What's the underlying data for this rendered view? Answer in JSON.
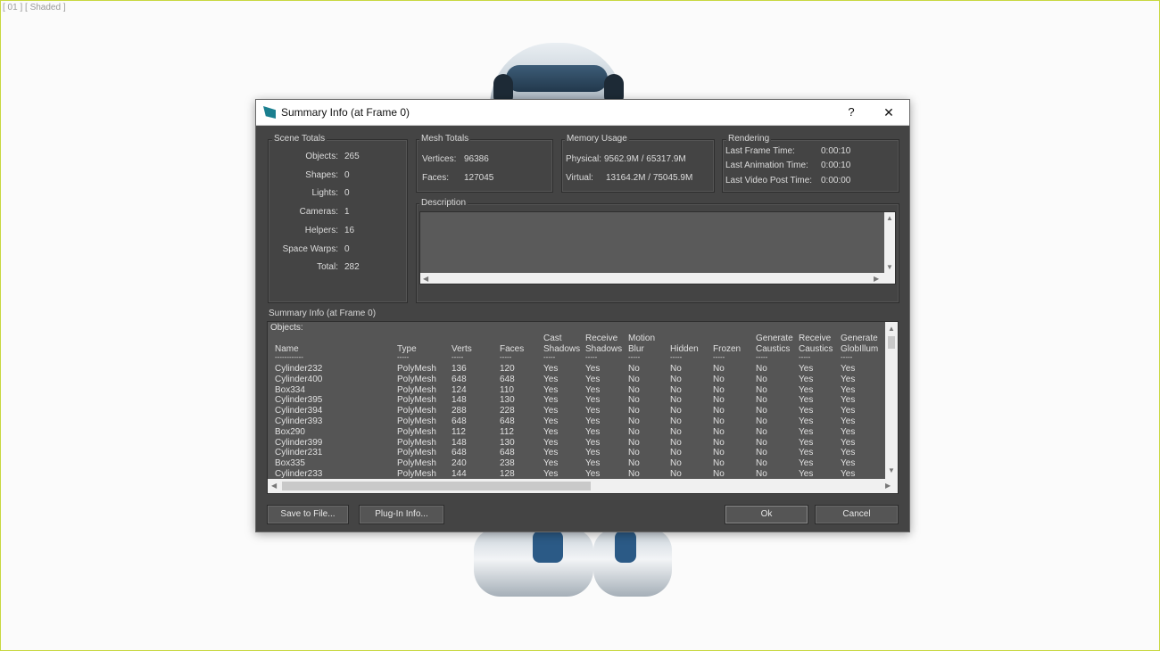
{
  "viewport": {
    "label": "[ 01 ] [ Shaded ]"
  },
  "dialog": {
    "title": "Summary Info (at Frame 0)",
    "help": "?",
    "close": "✕"
  },
  "scene_totals": {
    "title": "Scene Totals",
    "rows": [
      {
        "label": "Objects:",
        "value": "265"
      },
      {
        "label": "Shapes:",
        "value": "0"
      },
      {
        "label": "Lights:",
        "value": "0"
      },
      {
        "label": "Cameras:",
        "value": "1"
      },
      {
        "label": "Helpers:",
        "value": "16"
      },
      {
        "label": "Space Warps:",
        "value": "0"
      },
      {
        "label": "Total:",
        "value": "282"
      }
    ]
  },
  "mesh_totals": {
    "title": "Mesh Totals",
    "rows": [
      {
        "label": "Vertices:",
        "value": "96386"
      },
      {
        "label": "Faces:",
        "value": "127045"
      }
    ]
  },
  "memory_usage": {
    "title": "Memory Usage",
    "rows": [
      {
        "label": "Physical:",
        "value": "9562.9M / 65317.9M"
      },
      {
        "label": "Virtual:",
        "value": "13164.2M / 75045.9M"
      }
    ]
  },
  "rendering": {
    "title": "Rendering",
    "rows": [
      {
        "label": "Last Frame Time:",
        "value": "0:00:10"
      },
      {
        "label": "Last Animation Time:",
        "value": "0:00:10"
      },
      {
        "label": "Last Video Post Time:",
        "value": "0:00:00"
      }
    ]
  },
  "description": {
    "title": "Description",
    "value": ""
  },
  "summary": {
    "label": "Summary Info (at Frame 0)",
    "objects_heading": "Objects:",
    "columns": [
      {
        "line1": "",
        "line2": "Name"
      },
      {
        "line1": "",
        "line2": "Type"
      },
      {
        "line1": "",
        "line2": "Verts"
      },
      {
        "line1": "",
        "line2": "Faces"
      },
      {
        "line1": "Cast",
        "line2": "Shadows"
      },
      {
        "line1": "Receive",
        "line2": "Shadows"
      },
      {
        "line1": "Motion",
        "line2": "Blur"
      },
      {
        "line1": "",
        "line2": "Hidden"
      },
      {
        "line1": "",
        "line2": "Frozen"
      },
      {
        "line1": "Generate",
        "line2": "Caustics"
      },
      {
        "line1": "Receive",
        "line2": "Caustics"
      },
      {
        "line1": "Generate",
        "line2": "GlobIllum"
      }
    ],
    "separators": [
      "------------",
      "-----",
      "-----",
      "-----",
      "-----",
      "-----",
      "-----",
      "-----",
      "-----",
      "-----",
      "-----",
      "-----"
    ],
    "rows": [
      [
        "Cylinder232",
        "PolyMesh",
        "136",
        "120",
        "Yes",
        "Yes",
        "No",
        "No",
        "No",
        "No",
        "Yes",
        "Yes"
      ],
      [
        "Cylinder400",
        "PolyMesh",
        "648",
        "648",
        "Yes",
        "Yes",
        "No",
        "No",
        "No",
        "No",
        "Yes",
        "Yes"
      ],
      [
        "Box334",
        "PolyMesh",
        "124",
        "110",
        "Yes",
        "Yes",
        "No",
        "No",
        "No",
        "No",
        "Yes",
        "Yes"
      ],
      [
        "Cylinder395",
        "PolyMesh",
        "148",
        "130",
        "Yes",
        "Yes",
        "No",
        "No",
        "No",
        "No",
        "Yes",
        "Yes"
      ],
      [
        "Cylinder394",
        "PolyMesh",
        "288",
        "228",
        "Yes",
        "Yes",
        "No",
        "No",
        "No",
        "No",
        "Yes",
        "Yes"
      ],
      [
        "Cylinder393",
        "PolyMesh",
        "648",
        "648",
        "Yes",
        "Yes",
        "No",
        "No",
        "No",
        "No",
        "Yes",
        "Yes"
      ],
      [
        "Box290",
        "PolyMesh",
        "112",
        "112",
        "Yes",
        "Yes",
        "No",
        "No",
        "No",
        "No",
        "Yes",
        "Yes"
      ],
      [
        "Cylinder399",
        "PolyMesh",
        "148",
        "130",
        "Yes",
        "Yes",
        "No",
        "No",
        "No",
        "No",
        "Yes",
        "Yes"
      ],
      [
        "Cylinder231",
        "PolyMesh",
        "648",
        "648",
        "Yes",
        "Yes",
        "No",
        "No",
        "No",
        "No",
        "Yes",
        "Yes"
      ],
      [
        "Box335",
        "PolyMesh",
        "240",
        "238",
        "Yes",
        "Yes",
        "No",
        "No",
        "No",
        "No",
        "Yes",
        "Yes"
      ],
      [
        "Cylinder233",
        "PolyMesh",
        "144",
        "128",
        "Yes",
        "Yes",
        "No",
        "No",
        "No",
        "No",
        "Yes",
        "Yes"
      ]
    ]
  },
  "buttons": {
    "save": "Save to File...",
    "plugin": "Plug-In Info...",
    "ok": "Ok",
    "cancel": "Cancel"
  },
  "icons": {
    "app": "3dsmax-app-icon",
    "scroll_up": "▲",
    "scroll_down": "▼",
    "scroll_left": "◀",
    "scroll_right": "▶"
  }
}
